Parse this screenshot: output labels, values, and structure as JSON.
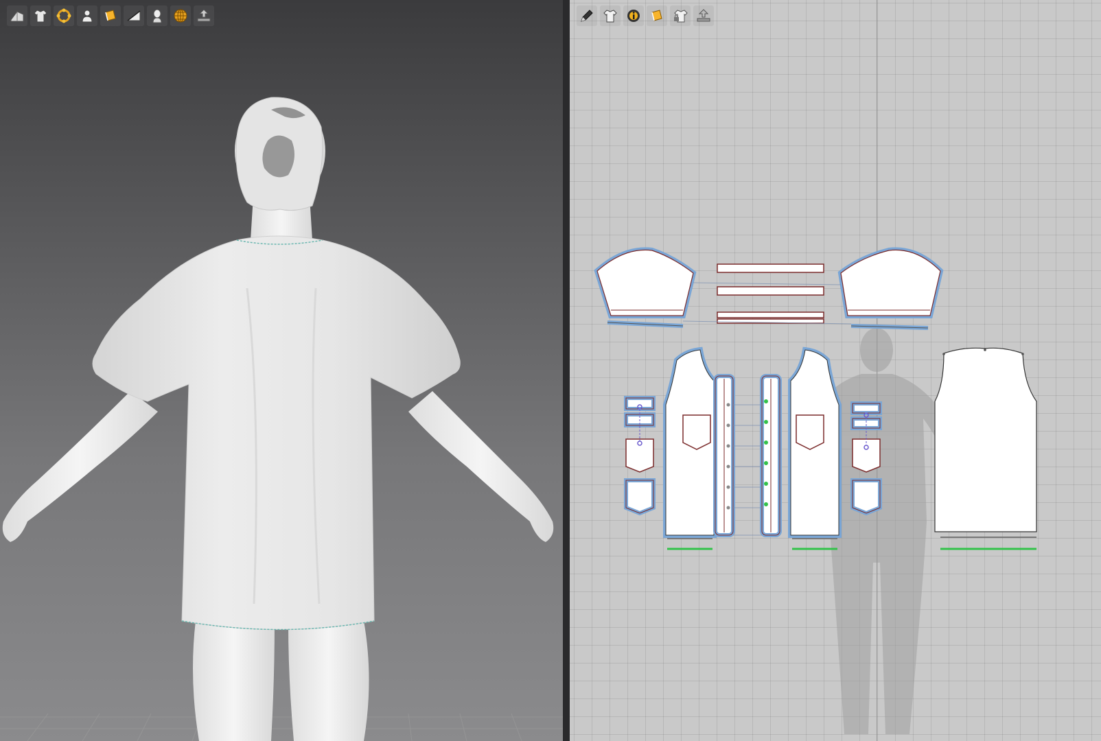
{
  "colors": {
    "viewport3d_top": "#3b3b3d",
    "viewport3d_bottom": "#8b8b8d",
    "viewport2d_bg": "#c9c9c9",
    "pattern_outline_selected": "#7aa6d6",
    "pattern_stroke": "#7a2a2a",
    "seam_green": "#33c24a",
    "avatar": "#f1f1f1"
  },
  "toolbar_3d": {
    "tools": [
      {
        "icon": "avatar-fabric-icon"
      },
      {
        "icon": "shirt-visibility-icon"
      },
      {
        "icon": "fabric-points-icon"
      },
      {
        "icon": "avatar-visibility-icon"
      },
      {
        "icon": "texture-icon"
      },
      {
        "icon": "render-mode-icon"
      },
      {
        "icon": "avatar-silhouette-icon"
      },
      {
        "icon": "globe-grid-icon"
      },
      {
        "icon": "export-icon"
      }
    ]
  },
  "toolbar_2d": {
    "tools": [
      {
        "icon": "pen-edit-icon"
      },
      {
        "icon": "shirt-visibility-icon"
      },
      {
        "icon": "info-icon"
      },
      {
        "icon": "texture-icon"
      },
      {
        "icon": "lock-garment-icon"
      },
      {
        "icon": "export-icon"
      }
    ]
  }
}
